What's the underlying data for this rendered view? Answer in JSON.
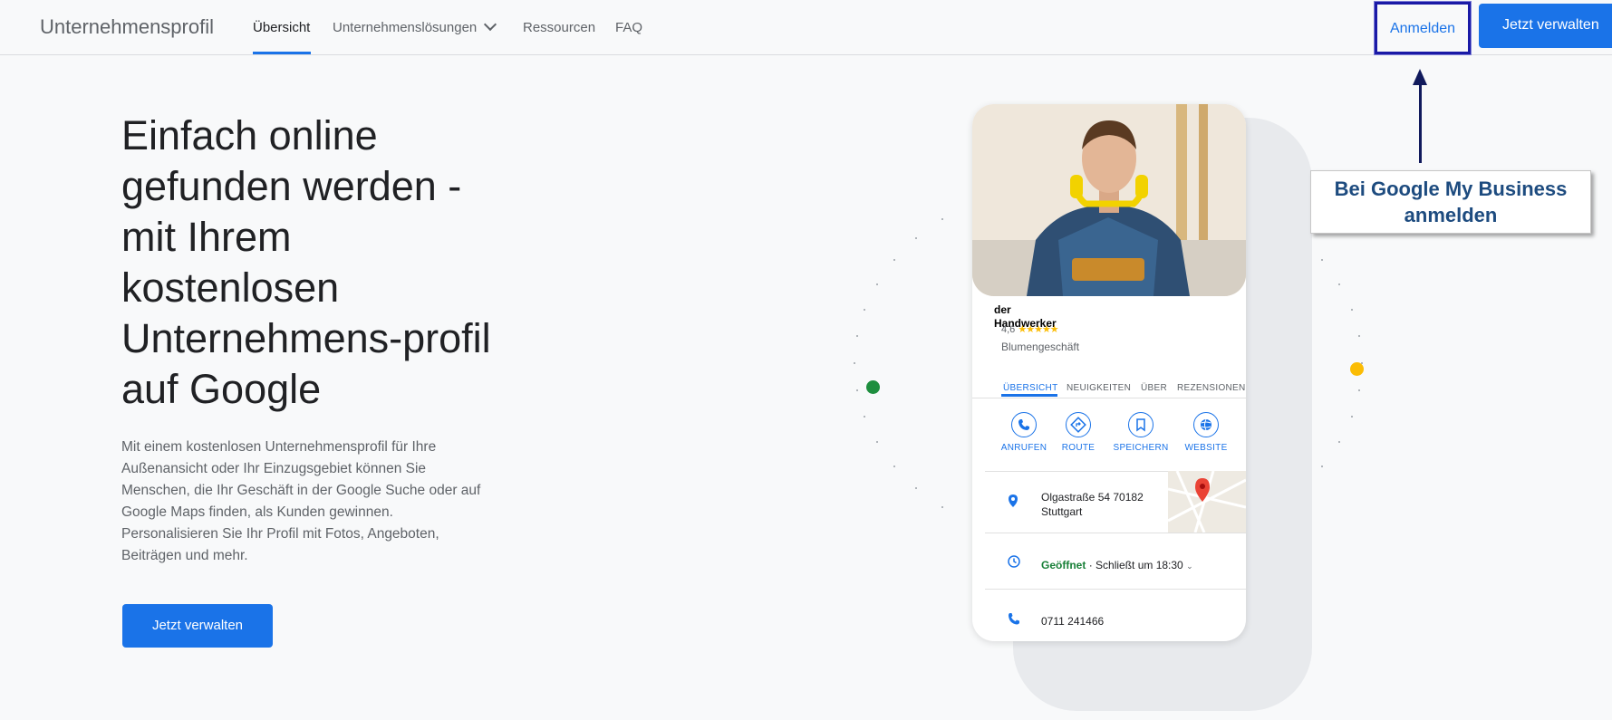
{
  "header": {
    "brand": "Unternehmensprofil",
    "nav": [
      {
        "label": "Übersicht",
        "active": true
      },
      {
        "label": "Unternehmenslösungen"
      },
      {
        "label": "Ressourcen"
      },
      {
        "label": "FAQ"
      }
    ],
    "login_label": "Anmelden",
    "manage_label": "Jetzt verwalten"
  },
  "hero": {
    "headline": "Einfach online gefunden werden - mit Ihrem kostenlosen Unternehmens-profil auf Google",
    "subtext": "Mit einem kostenlosen Unternehmensprofil für Ihre Außenansicht oder Ihr Einzugsgebiet können Sie Menschen, die Ihr Geschäft in der Google Suche oder auf Google Maps finden, als Kunden gewinnen. Personalisieren Sie Ihr Profil mit Fotos, Angeboten, Beiträgen und mehr.",
    "cta_label": "Jetzt verwalten"
  },
  "profile_card": {
    "business_name": "der Handwerker",
    "rating": "4,6",
    "stars": "★★★★★",
    "category": "Blumengeschäft",
    "tabs": [
      "ÜBERSICHT",
      "NEUIGKEITEN",
      "ÜBER",
      "REZENSIONEN"
    ],
    "actions": [
      {
        "label": "ANRUFEN",
        "icon": "phone-icon"
      },
      {
        "label": "ROUTE",
        "icon": "directions-icon"
      },
      {
        "label": "SPEICHERN",
        "icon": "bookmark-icon"
      },
      {
        "label": "WEBSITE",
        "icon": "globe-icon"
      }
    ],
    "address_line1": "Olgastraße 54 70182",
    "address_line2": "Stuttgart",
    "open_status": "Geöffnet",
    "closes": "· Schließt um 18:30",
    "phone": "0711 241466"
  },
  "annotation": {
    "line1": "Bei Google My Business",
    "line2": "anmelden"
  },
  "colors": {
    "accent": "#1a73e8",
    "annotation_border": "#1a1aa6",
    "annotation_text": "#1d4b7f",
    "open_green": "#188038",
    "dot_green": "#1e8e3e",
    "dot_yellow": "#fbbc04"
  }
}
